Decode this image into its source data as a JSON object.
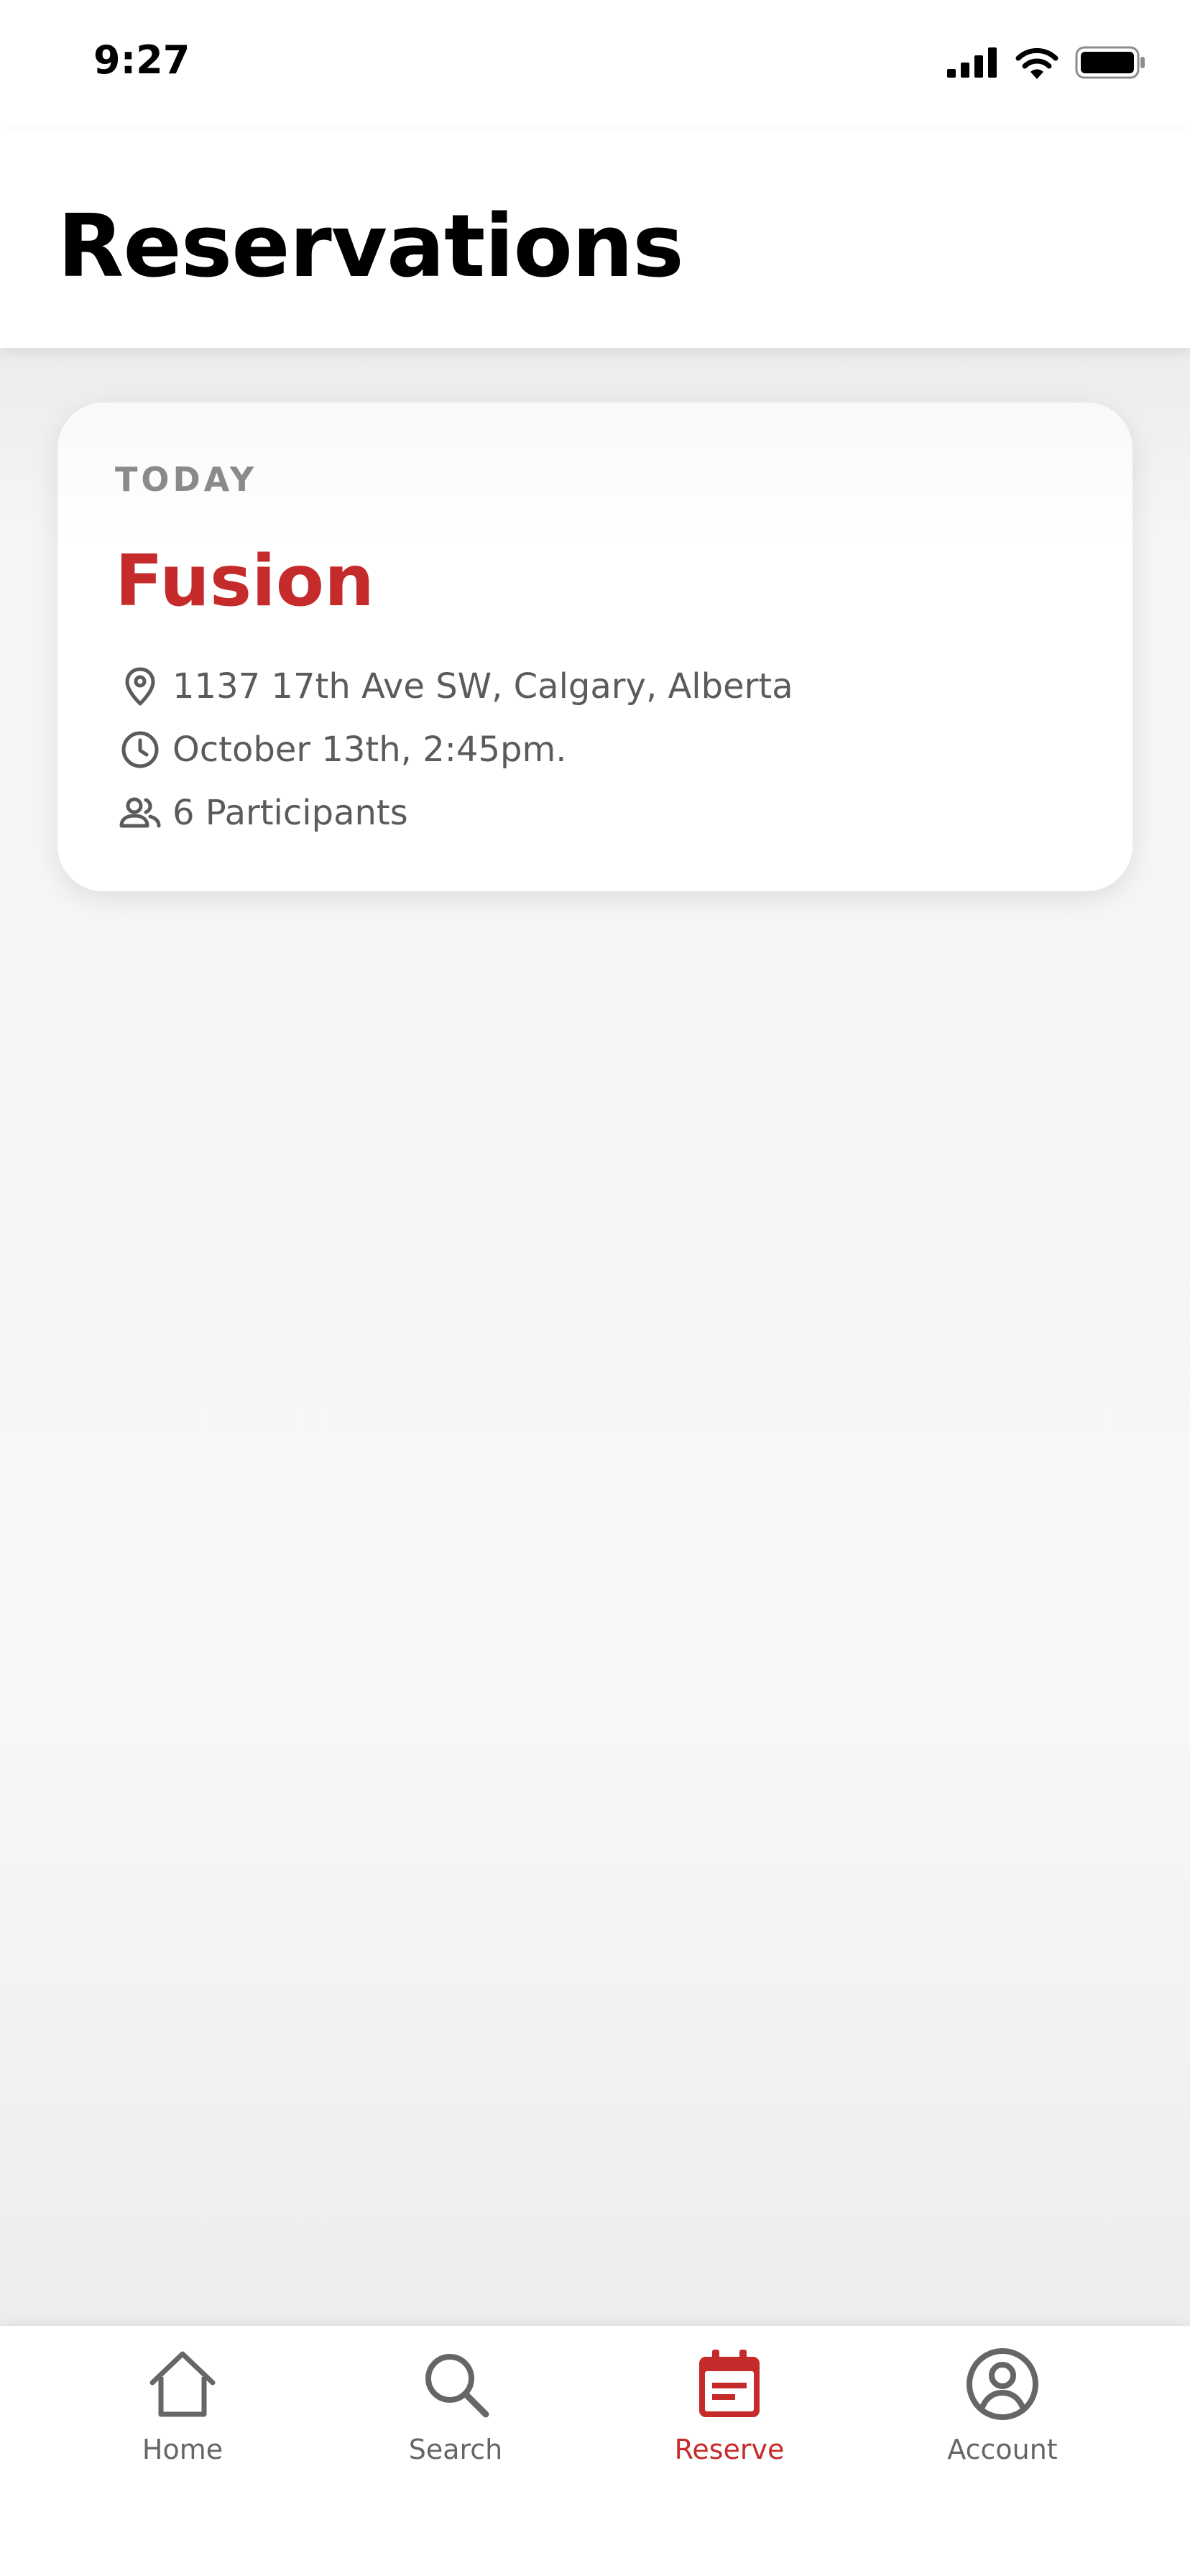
{
  "status_bar": {
    "time": "9:27"
  },
  "header": {
    "title": "Reservations"
  },
  "reservations": [
    {
      "day": "TODAY",
      "name": "Fusion",
      "address": "1137 17th Ave SW, Calgary, Alberta",
      "datetime": "October 13th, 2:45pm.",
      "participants": "6 Participants"
    }
  ],
  "tabs": [
    {
      "label": "Home",
      "icon": "home-icon",
      "active": false
    },
    {
      "label": "Search",
      "icon": "search-icon",
      "active": false
    },
    {
      "label": "Reserve",
      "icon": "calendar-icon",
      "active": true
    },
    {
      "label": "Account",
      "icon": "account-icon",
      "active": false
    }
  ],
  "colors": {
    "accent": "#c62b2b",
    "text_secondary": "#5b5b5b",
    "tab_inactive": "#666666"
  }
}
